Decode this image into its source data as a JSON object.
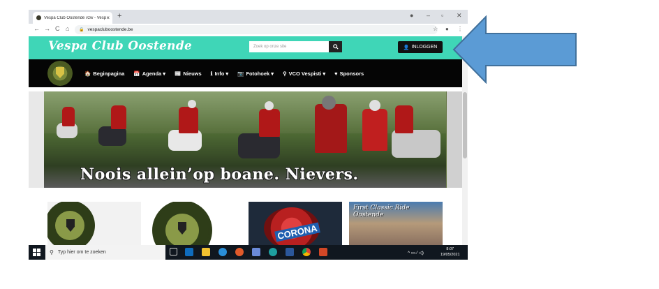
{
  "browser": {
    "tab_title": "Vespa Club Oostende vzw - Vesp",
    "tab_close": "×",
    "new_tab": "+",
    "url": "vespacluboostende.be",
    "window_controls": {
      "minimize": "–",
      "maximize": "▫",
      "close": "✕"
    },
    "nav_icons": {
      "back": "←",
      "forward": "→",
      "reload": "C",
      "home": "⌂"
    }
  },
  "site": {
    "logo_text": "Vespa Club Oostende",
    "search_placeholder": "Zoek op onze site",
    "search_icon": "search-icon",
    "login_label": "INLOGGEN",
    "nav": [
      {
        "icon": "🏠",
        "label": "Beginpagina"
      },
      {
        "icon": "📅",
        "label": "Agenda ▾"
      },
      {
        "icon": "📰",
        "label": "Nieuws"
      },
      {
        "icon": "ℹ",
        "label": "Info ▾"
      },
      {
        "icon": "📷",
        "label": "Fotohoek ▾"
      },
      {
        "icon": "⚲",
        "label": "VCO Vespisti ▾"
      },
      {
        "icon": "♥",
        "label": "Sponsors"
      }
    ],
    "banner_slogan": "Noois allein’op boane. Nievers.",
    "thumbnails": [
      {
        "caption": ""
      },
      {
        "caption": ""
      },
      {
        "caption": "CORONA"
      },
      {
        "caption": "First Classic Ride Oostende"
      }
    ]
  },
  "taskbar": {
    "search_placeholder": "Typ hier om te zoeken",
    "time": "8:07",
    "date": "19/05/2021",
    "tray_icons": "^ ▭ ⁄ ◁)"
  },
  "colors": {
    "header_teal": "#3fd6b7",
    "nav_black": "#050505",
    "arrow_blue": "#5b9bd5",
    "arrow_border": "#41719c"
  }
}
